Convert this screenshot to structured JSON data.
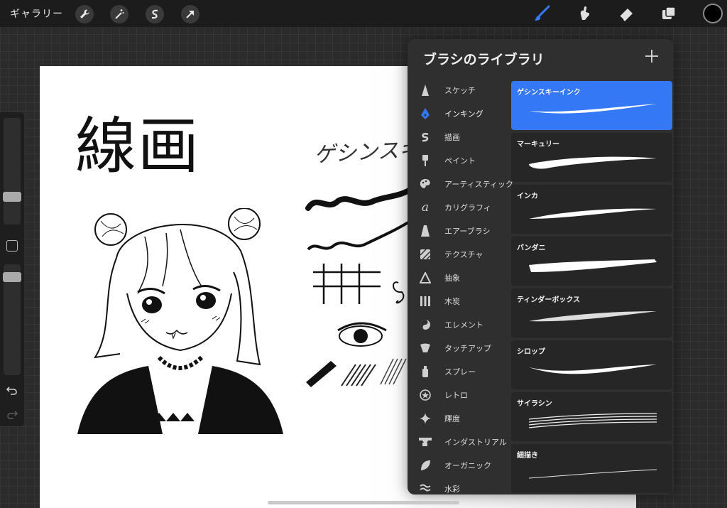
{
  "topbar": {
    "gallery_label": "ギャラリー",
    "left_tools": [
      "wrench-icon",
      "magic-wand-icon",
      "selection-icon",
      "transform-arrow-icon"
    ],
    "right_tools": [
      "brush-icon",
      "smudge-icon",
      "eraser-icon",
      "layers-icon"
    ],
    "active_tool_color": "#3478f6",
    "current_color": "#000000"
  },
  "sidebar": {
    "undo_icon": "undo-icon",
    "redo_icon": "redo-icon"
  },
  "canvas": {
    "title": "線画",
    "handwritten_label": "ゲシンスキー"
  },
  "brush_library": {
    "title": "ブラシのライブラリ",
    "add_icon": "plus-icon",
    "categories": [
      {
        "label": "スケッチ",
        "icon": "pencil-icon"
      },
      {
        "label": "インキング",
        "icon": "pen-nib-icon",
        "active": true
      },
      {
        "label": "描画",
        "icon": "swirl-icon"
      },
      {
        "label": "ペイント",
        "icon": "paint-brush-icon"
      },
      {
        "label": "アーティスティック",
        "icon": "palette-icon"
      },
      {
        "label": "カリグラフィ",
        "icon": "calligraphy-icon"
      },
      {
        "label": "エアーブラシ",
        "icon": "airbrush-icon"
      },
      {
        "label": "テクスチャ",
        "icon": "texture-icon"
      },
      {
        "label": "抽象",
        "icon": "triangle-icon"
      },
      {
        "label": "木炭",
        "icon": "charcoal-icon"
      },
      {
        "label": "エレメント",
        "icon": "yin-yang-icon"
      },
      {
        "label": "タッチアップ",
        "icon": "touchup-icon"
      },
      {
        "label": "スプレー",
        "icon": "spray-can-icon"
      },
      {
        "label": "レトロ",
        "icon": "star-badge-icon"
      },
      {
        "label": "輝度",
        "icon": "sparkle-icon"
      },
      {
        "label": "インダストリアル",
        "icon": "anvil-icon"
      },
      {
        "label": "オーガニック",
        "icon": "leaf-icon"
      },
      {
        "label": "水彩",
        "icon": "waves-icon"
      }
    ],
    "brushes": [
      {
        "name": "ゲシンスキーインク",
        "selected": true
      },
      {
        "name": "マーキュリー"
      },
      {
        "name": "インカ"
      },
      {
        "name": "バンダニ"
      },
      {
        "name": "ティンダーボックス"
      },
      {
        "name": "シロップ"
      },
      {
        "name": "サイラシン"
      },
      {
        "name": "細描き"
      }
    ]
  }
}
